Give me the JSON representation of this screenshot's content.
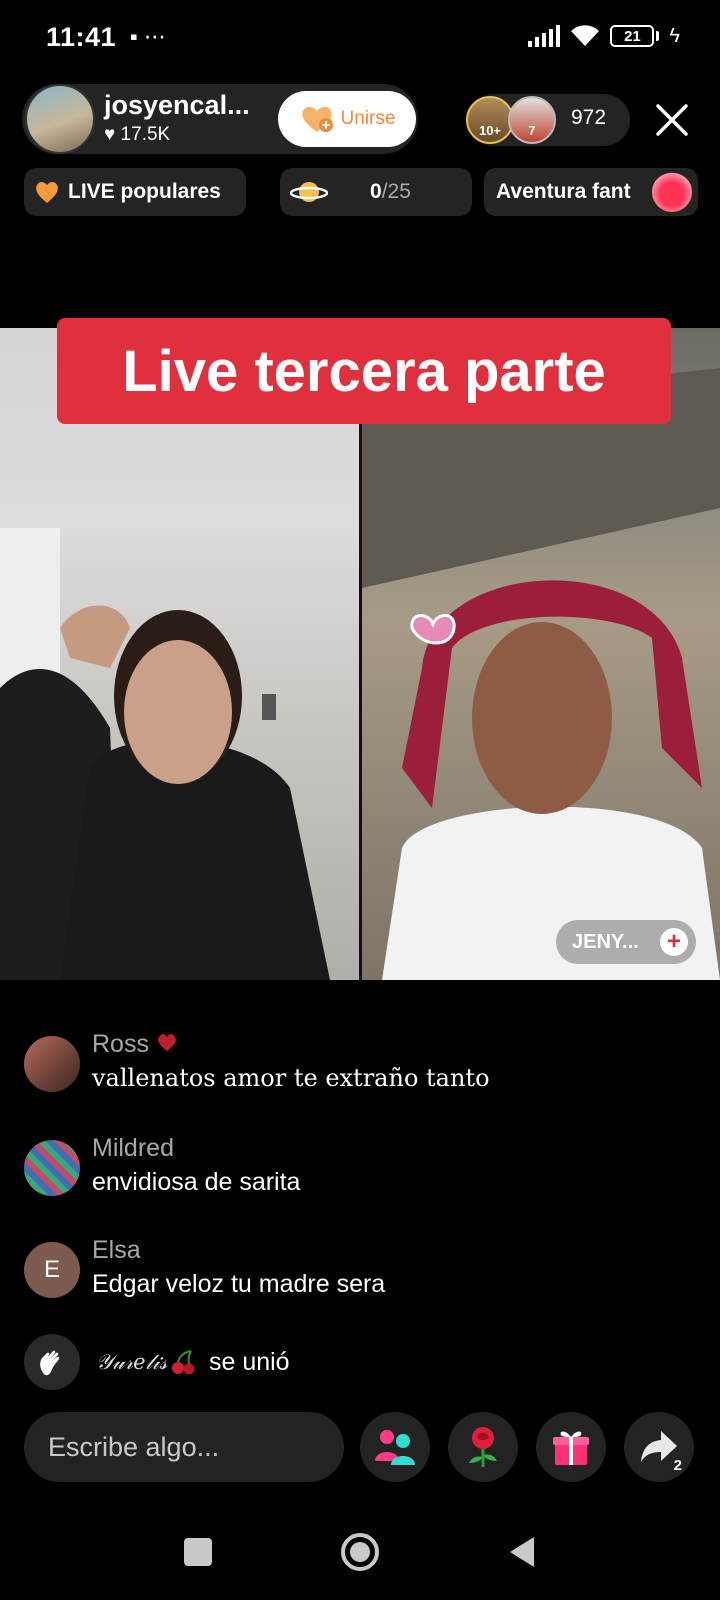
{
  "status_bar": {
    "time": "11:41",
    "left_icons": "▪ ⋯",
    "battery": "21",
    "bolt": "ϟ"
  },
  "host": {
    "name": "josyencal...",
    "likes": "♥ 17.5K",
    "join_label": "Unirse",
    "accent_color": "#f08a3a"
  },
  "viewers": {
    "badge_a": "10+",
    "badge_b": "7",
    "count": "972"
  },
  "popular": {
    "label": "LIVE populares"
  },
  "progress": {
    "current": "0",
    "total": "/25"
  },
  "adventure": {
    "label": "Aventura fant"
  },
  "stream": {
    "banner": "Live tercera parte",
    "banner_color": "#e0303d",
    "guest_tag": "JENY...",
    "guest_plus": "+"
  },
  "comments": [
    {
      "name": "Ross",
      "text": "vallenatos amor te extraño tanto",
      "avatar": ""
    },
    {
      "name": "Mildred",
      "text": "envidiosa de sarita",
      "avatar": ""
    },
    {
      "name": "Elsa",
      "text": "Edgar veloz tu madre sera",
      "avatar": "E"
    }
  ],
  "join_event": {
    "user": "𝒴𝓊𝓇𝑒𝓁𝒾𝓈",
    "message": "se unió"
  },
  "composer": {
    "placeholder": "Escribe algo..."
  },
  "share": {
    "count": "2"
  },
  "icons": [
    "video-icon",
    "more-icon",
    "signal-icon",
    "wifi-icon",
    "battery-icon",
    "close-icon",
    "broken-heart-icon",
    "planet-icon",
    "heart-badge-icon",
    "wave-hand-icon",
    "guests-icon",
    "rose-icon",
    "gift-icon",
    "share-icon",
    "nav-recents-icon",
    "nav-home-icon",
    "nav-back-icon"
  ]
}
